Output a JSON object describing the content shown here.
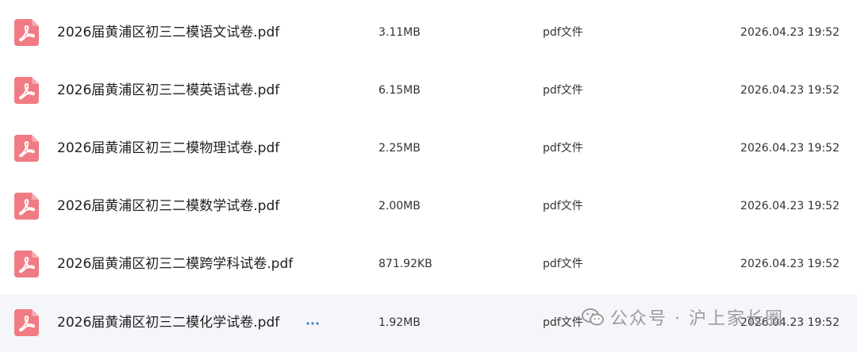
{
  "colors": {
    "pdf_icon": "#f07b84",
    "hover_row": "#f5f6fa",
    "more_dots": "#3b82c4",
    "watermark": "#8c8c8c"
  },
  "icons": {
    "file_icon": "pdf-file-icon",
    "more_icon": "ellipsis-icon",
    "watermark_icon": "wechat-icon"
  },
  "files": [
    {
      "name": "2026届黄浦区初三二模语文试卷.pdf",
      "size": "3.11MB",
      "type": "pdf文件",
      "time": "2026.04.23 19:52"
    },
    {
      "name": "2026届黄浦区初三二模英语试卷.pdf",
      "size": "6.15MB",
      "type": "pdf文件",
      "time": "2026.04.23 19:52"
    },
    {
      "name": "2026届黄浦区初三二模物理试卷.pdf",
      "size": "2.25MB",
      "type": "pdf文件",
      "time": "2026.04.23 19:52"
    },
    {
      "name": "2026届黄浦区初三二模数学试卷.pdf",
      "size": "2.00MB",
      "type": "pdf文件",
      "time": "2026.04.23 19:52"
    },
    {
      "name": "2026届黄浦区初三二模跨学科试卷.pdf",
      "size": "871.92KB",
      "type": "pdf文件",
      "time": "2026.04.23 19:52"
    },
    {
      "name": "2026届黄浦区初三二模化学试卷.pdf",
      "size": "1.92MB",
      "type": "pdf文件",
      "time": "2026.04.23 19:52"
    }
  ],
  "more_button": {
    "label": "···"
  },
  "watermark": {
    "text": "公众号 · 沪上家长圈"
  }
}
